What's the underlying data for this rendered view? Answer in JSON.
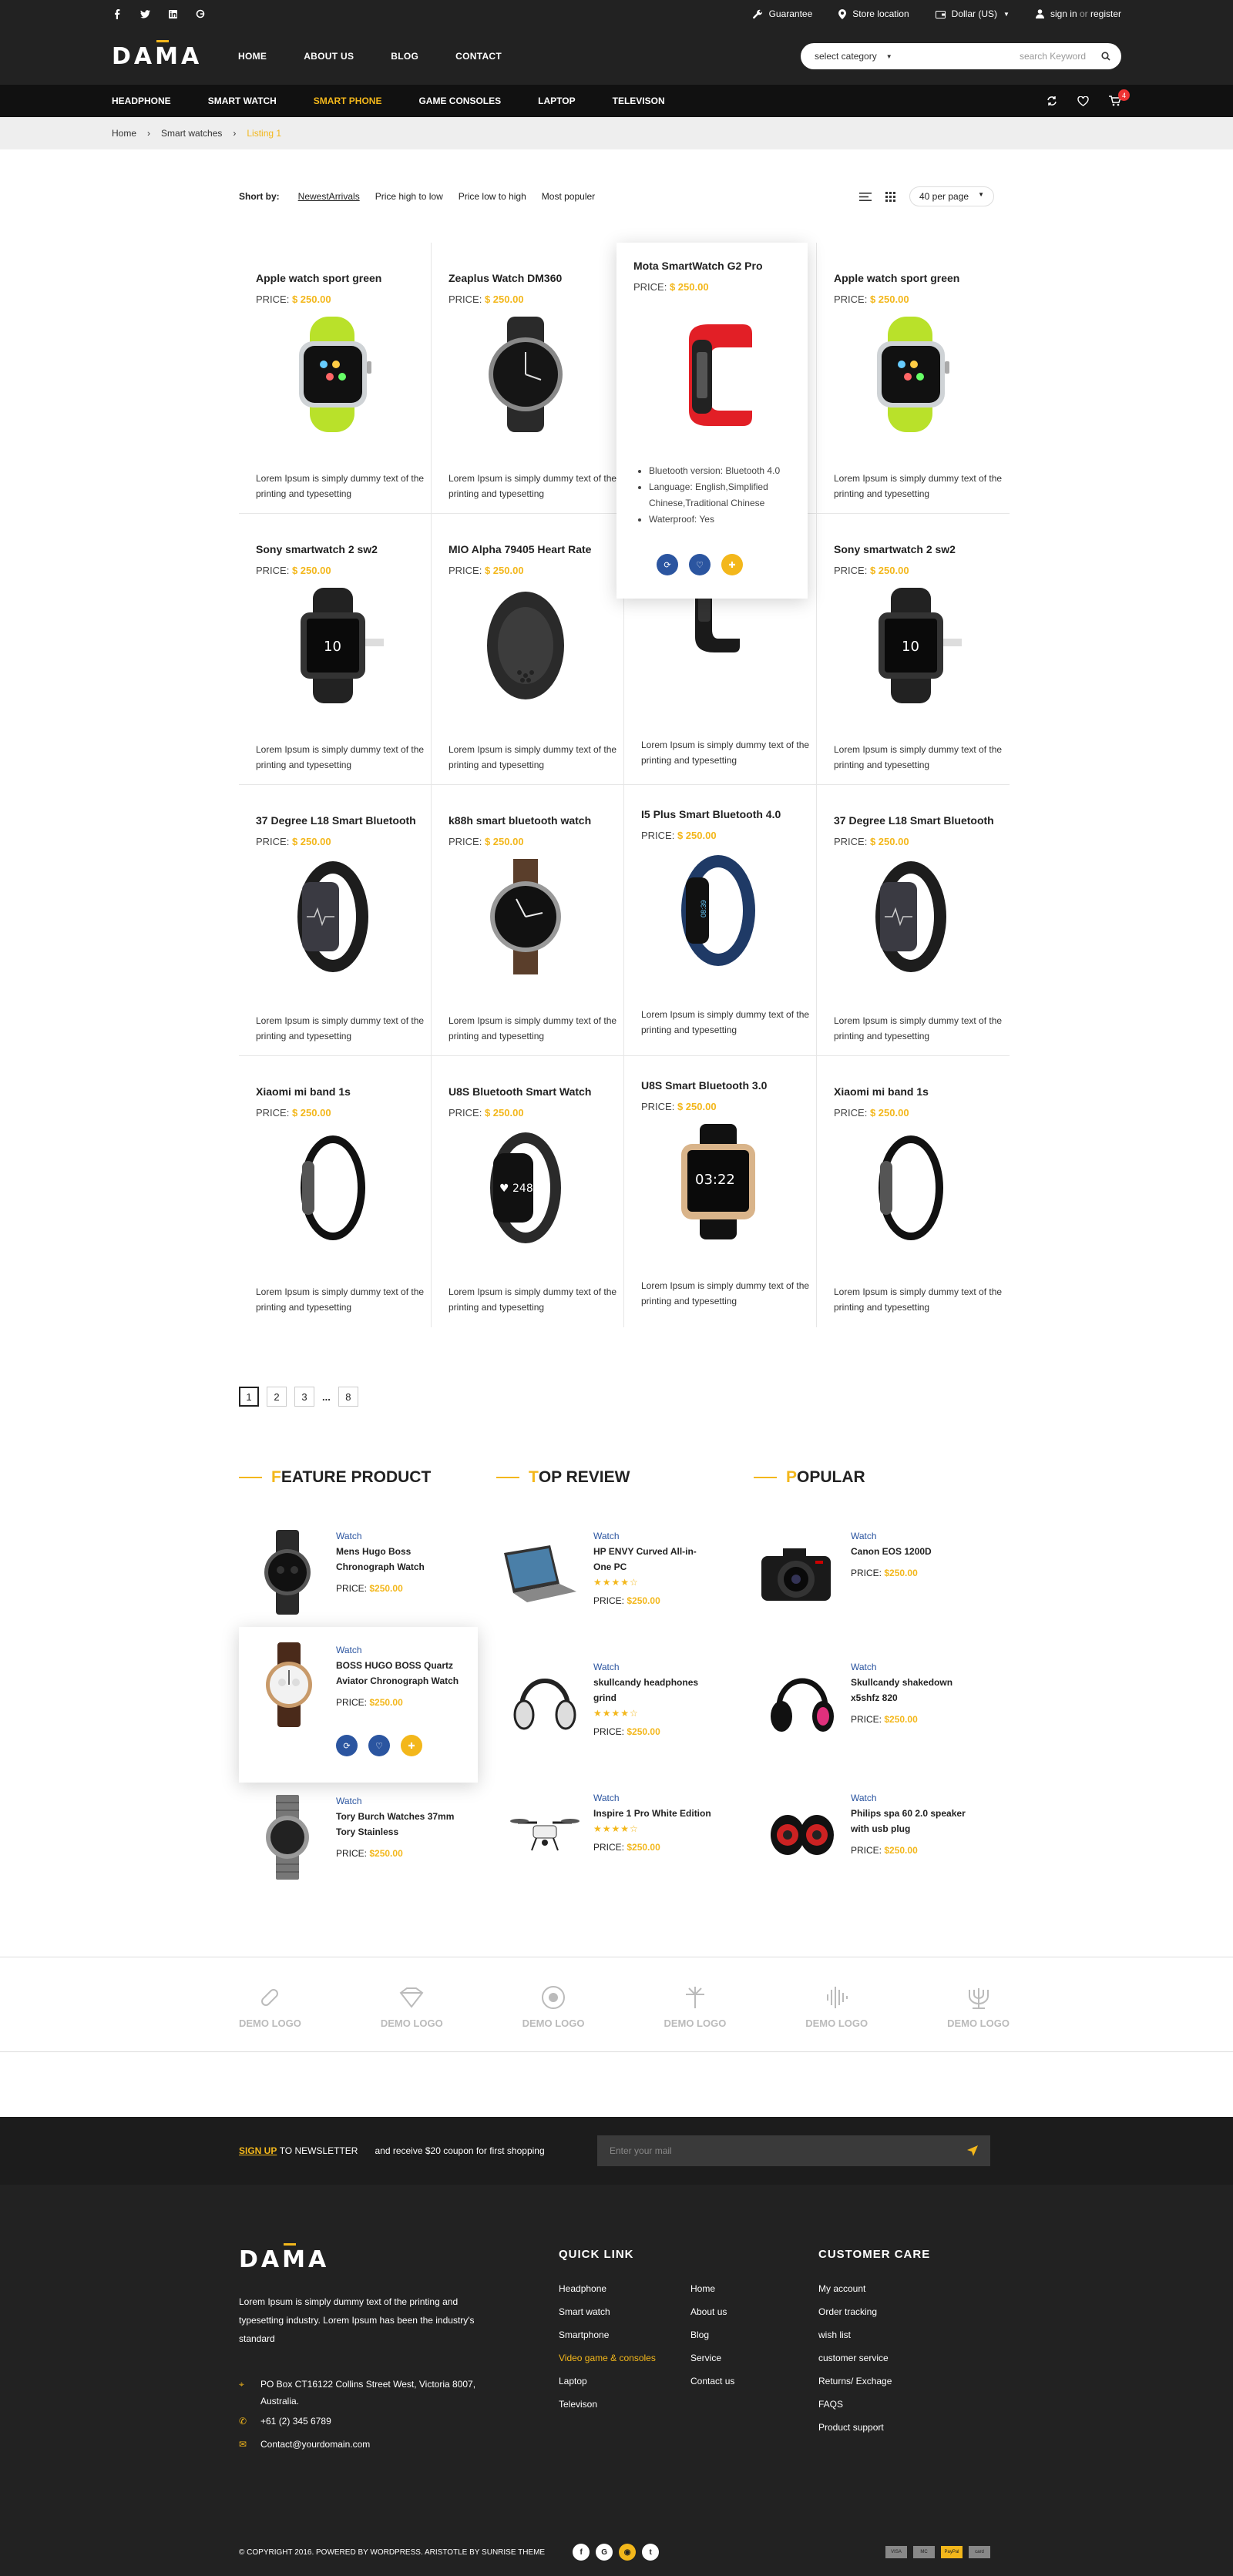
{
  "topbar": {
    "guarantee": "Guarantee",
    "store": "Store location",
    "currency": "Dollar (US)",
    "signin": "sign in",
    "or": "or",
    "register": "register"
  },
  "header": {
    "logo": "DAMA",
    "nav": [
      "HOME",
      "ABOUT US",
      "BLOG",
      "CONTACT"
    ],
    "search_category": "select category",
    "search_placeholder": "search Keyword"
  },
  "categories": {
    "items": [
      "HEADPHONE",
      "SMART WATCH",
      "SMART PHONE",
      "GAME CONSOLES",
      "LAPTOP",
      "TELEVISON"
    ],
    "active": "SMART PHONE",
    "cart_count": "4"
  },
  "breadcrumb": [
    "Home",
    "Smart watches",
    "Listing 1"
  ],
  "sort": {
    "label": "Short by:",
    "options": [
      "NewestArrivals",
      "Price high to low",
      "Price low to high",
      "Most populer"
    ],
    "per_page": "40 per page"
  },
  "products": {
    "price_label": "PRICE:",
    "desc": "Lorem Ipsum is simply dummy text of the printing and typesetting",
    "items": [
      {
        "name": "Apple watch sport green",
        "price": "$ 250.00"
      },
      {
        "name": "Zeaplus Watch DM360",
        "price": "$ 250.00"
      },
      {
        "name": "Mota SmartWatch G2 Pro",
        "price": "$ 250.00"
      },
      {
        "name": "Apple watch sport green",
        "price": "$ 250.00"
      },
      {
        "name": "Sony smartwatch 2 sw2",
        "price": "$ 250.00"
      },
      {
        "name": "MIO Alpha 79405 Heart Rate",
        "price": "$ 250.00"
      },
      {
        "name": "",
        "price": ""
      },
      {
        "name": "Sony smartwatch 2 sw2",
        "price": "$ 250.00"
      },
      {
        "name": "37 Degree L18 Smart Bluetooth",
        "price": "$ 250.00"
      },
      {
        "name": "k88h smart bluetooth watch",
        "price": "$ 250.00"
      },
      {
        "name": "I5 Plus Smart Bluetooth 4.0",
        "price": "$ 250.00"
      },
      {
        "name": "37 Degree L18 Smart Bluetooth",
        "price": "$ 250.00"
      },
      {
        "name": "Xiaomi mi band 1s",
        "price": "$ 250.00"
      },
      {
        "name": "U8S Bluetooth Smart Watch",
        "price": "$ 250.00"
      },
      {
        "name": "U8S Smart Bluetooth 3.0",
        "price": "$ 250.00"
      },
      {
        "name": "Xiaomi mi band 1s",
        "price": "$ 250.00"
      }
    ],
    "hover_specs": [
      "Bluetooth version: Bluetooth 4.0",
      "Language: English,Simplified Chinese,Traditional Chinese",
      "Waterproof: Yes"
    ]
  },
  "pagination": [
    "1",
    "2",
    "3",
    "...",
    "8"
  ],
  "featured": {
    "columns": [
      {
        "title_first": "F",
        "title_rest": "EATURE PRODUCT",
        "items": [
          {
            "cat": "Watch",
            "name": "Mens Hugo Boss Chronograph Watch",
            "price": "$250.00"
          },
          {
            "cat": "Watch",
            "name": "BOSS HUGO BOSS Quartz Aviator Chronograph Watch",
            "price": "$250.00"
          },
          {
            "cat": "Watch",
            "name": "Tory Burch Watches 37mm Tory Stainless",
            "price": "$250.00"
          }
        ]
      },
      {
        "title_first": "T",
        "title_rest": "OP REVIEW",
        "items": [
          {
            "cat": "Watch",
            "name": "HP ENVY Curved All-in-One PC",
            "price": "$250.00"
          },
          {
            "cat": "Watch",
            "name": "skullcandy headphones grind",
            "price": "$250.00"
          },
          {
            "cat": "Watch",
            "name": "Inspire 1 Pro White Edition",
            "price": "$250.00"
          }
        ]
      },
      {
        "title_first": "P",
        "title_rest": "OPULAR",
        "items": [
          {
            "cat": "Watch",
            "name": "Canon EOS 1200D",
            "price": "$250.00"
          },
          {
            "cat": "Watch",
            "name": "Skullcandy shakedown x5shfz 820",
            "price": "$250.00"
          },
          {
            "cat": "Watch",
            "name": "Philips spa 60 2.0 speaker with usb plug",
            "price": "$250.00"
          }
        ]
      }
    ],
    "price_label": "PRICE:"
  },
  "brands": [
    "DEMO LOGO",
    "DEMO LOGO",
    "DEMO LOGO",
    "DEMO LOGO",
    "DEMO LOGO",
    "DEMO LOGO"
  ],
  "newsletter": {
    "signup": "SIGN UP",
    "to": "TO NEWSLETTER",
    "offer": "and receive $20 coupon for first shopping",
    "placeholder": "Enter your mail"
  },
  "footer": {
    "about": "Lorem Ipsum is simply dummy text of the printing and typesetting industry. Lorem Ipsum has been the industry's standard",
    "address": "PO Box CT16122 Collins Street West, Victoria 8007, Australia.",
    "phone": "+61 (2) 345 6789",
    "email": "Contact@yourdomain.com",
    "quick_title": "QUICK LINK",
    "quick_a": [
      "Headphone",
      "Smart watch",
      "Smartphone",
      "Video game & consoles",
      "Laptop",
      "Televison"
    ],
    "quick_b": [
      "Home",
      "About us",
      "Blog",
      "Service",
      "Contact us"
    ],
    "care_title": "CUSTOMER CARE",
    "care": [
      "My account",
      "Order tracking",
      "wish list",
      "customer service",
      "Returns/ Exchage",
      "FAQS",
      "Product support"
    ],
    "copyright": "© COPYRIGHT 2016. POWERED BY WORDPRESS. ARISTOTLE  BY SUNRISE THEME",
    "payments": [
      "VISA",
      "MC",
      "PayPal",
      "card"
    ]
  },
  "colors": {
    "accent": "#f3b71b",
    "dark": "#222222",
    "blue": "#2b55a0"
  }
}
